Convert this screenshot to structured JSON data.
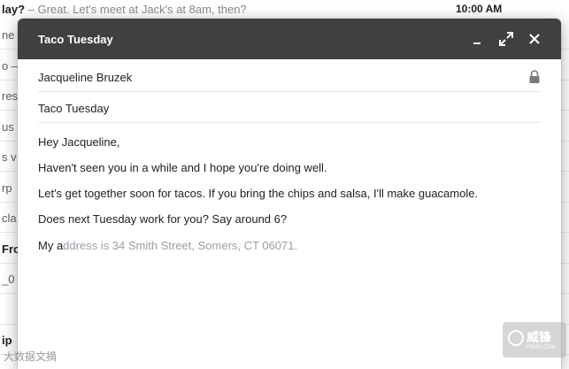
{
  "inbox": {
    "top_row": {
      "subject": "lay?",
      "snippet": " – Great. Let's meet at Jack's at 8am, then?",
      "time": "10:00 AM"
    },
    "rows": [
      {
        "text": "ne",
        "bold": false
      },
      {
        "text": "o –",
        "bold": false
      },
      {
        "text": "res",
        "bold": false
      },
      {
        "text": "us",
        "bold": false
      },
      {
        "text": "s v",
        "bold": false
      },
      {
        "text": "rp",
        "bold": false
      },
      {
        "text": "cla",
        "bold": false
      },
      {
        "text": "Fro",
        "bold": true
      },
      {
        "text": "_0",
        "bold": false
      },
      {
        "text": "",
        "bold": false
      },
      {
        "text": "ip",
        "bold": true
      }
    ]
  },
  "compose": {
    "title": "Taco Tuesday",
    "to": "Jacqueline Bruzek",
    "subject": "Taco Tuesday",
    "body": {
      "line1": "Hey Jacqueline,",
      "line2": "Haven't seen you in a while and I hope you're doing well.",
      "line3": "Let's get together soon for tacos. If you bring the chips and salsa, I'll make guacamole.",
      "line4": "Does next Tuesday work for you? Say around 6?",
      "typed": "My a",
      "suggestion": "ddress is 34 Smith Street, Somers, CT 06071."
    }
  },
  "icons": {
    "minimize": "minimize-icon",
    "maximize": "expand-icon",
    "close": "close-icon",
    "lock": "lock-icon"
  },
  "colors": {
    "header_bg": "#404040",
    "suggestion_text": "#9aa0a6"
  },
  "watermarks": {
    "left": "大数据文摘",
    "logo_big": "威锋",
    "logo_small": "FENG.COM"
  }
}
